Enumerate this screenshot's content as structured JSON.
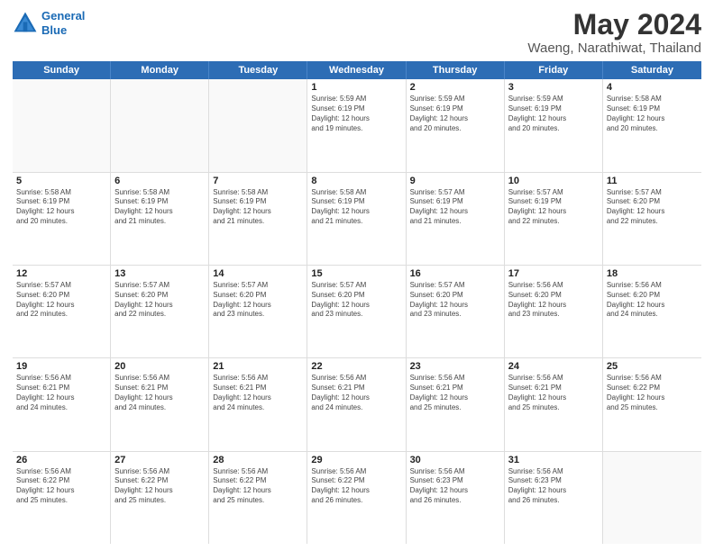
{
  "logo": {
    "line1": "General",
    "line2": "Blue"
  },
  "title": "May 2024",
  "subtitle": "Waeng, Narathiwat, Thailand",
  "weekdays": [
    "Sunday",
    "Monday",
    "Tuesday",
    "Wednesday",
    "Thursday",
    "Friday",
    "Saturday"
  ],
  "weeks": [
    [
      {
        "day": "",
        "info": ""
      },
      {
        "day": "",
        "info": ""
      },
      {
        "day": "",
        "info": ""
      },
      {
        "day": "1",
        "info": "Sunrise: 5:59 AM\nSunset: 6:19 PM\nDaylight: 12 hours\nand 19 minutes."
      },
      {
        "day": "2",
        "info": "Sunrise: 5:59 AM\nSunset: 6:19 PM\nDaylight: 12 hours\nand 20 minutes."
      },
      {
        "day": "3",
        "info": "Sunrise: 5:59 AM\nSunset: 6:19 PM\nDaylight: 12 hours\nand 20 minutes."
      },
      {
        "day": "4",
        "info": "Sunrise: 5:58 AM\nSunset: 6:19 PM\nDaylight: 12 hours\nand 20 minutes."
      }
    ],
    [
      {
        "day": "5",
        "info": "Sunrise: 5:58 AM\nSunset: 6:19 PM\nDaylight: 12 hours\nand 20 minutes."
      },
      {
        "day": "6",
        "info": "Sunrise: 5:58 AM\nSunset: 6:19 PM\nDaylight: 12 hours\nand 21 minutes."
      },
      {
        "day": "7",
        "info": "Sunrise: 5:58 AM\nSunset: 6:19 PM\nDaylight: 12 hours\nand 21 minutes."
      },
      {
        "day": "8",
        "info": "Sunrise: 5:58 AM\nSunset: 6:19 PM\nDaylight: 12 hours\nand 21 minutes."
      },
      {
        "day": "9",
        "info": "Sunrise: 5:57 AM\nSunset: 6:19 PM\nDaylight: 12 hours\nand 21 minutes."
      },
      {
        "day": "10",
        "info": "Sunrise: 5:57 AM\nSunset: 6:19 PM\nDaylight: 12 hours\nand 22 minutes."
      },
      {
        "day": "11",
        "info": "Sunrise: 5:57 AM\nSunset: 6:20 PM\nDaylight: 12 hours\nand 22 minutes."
      }
    ],
    [
      {
        "day": "12",
        "info": "Sunrise: 5:57 AM\nSunset: 6:20 PM\nDaylight: 12 hours\nand 22 minutes."
      },
      {
        "day": "13",
        "info": "Sunrise: 5:57 AM\nSunset: 6:20 PM\nDaylight: 12 hours\nand 22 minutes."
      },
      {
        "day": "14",
        "info": "Sunrise: 5:57 AM\nSunset: 6:20 PM\nDaylight: 12 hours\nand 23 minutes."
      },
      {
        "day": "15",
        "info": "Sunrise: 5:57 AM\nSunset: 6:20 PM\nDaylight: 12 hours\nand 23 minutes."
      },
      {
        "day": "16",
        "info": "Sunrise: 5:57 AM\nSunset: 6:20 PM\nDaylight: 12 hours\nand 23 minutes."
      },
      {
        "day": "17",
        "info": "Sunrise: 5:56 AM\nSunset: 6:20 PM\nDaylight: 12 hours\nand 23 minutes."
      },
      {
        "day": "18",
        "info": "Sunrise: 5:56 AM\nSunset: 6:20 PM\nDaylight: 12 hours\nand 24 minutes."
      }
    ],
    [
      {
        "day": "19",
        "info": "Sunrise: 5:56 AM\nSunset: 6:21 PM\nDaylight: 12 hours\nand 24 minutes."
      },
      {
        "day": "20",
        "info": "Sunrise: 5:56 AM\nSunset: 6:21 PM\nDaylight: 12 hours\nand 24 minutes."
      },
      {
        "day": "21",
        "info": "Sunrise: 5:56 AM\nSunset: 6:21 PM\nDaylight: 12 hours\nand 24 minutes."
      },
      {
        "day": "22",
        "info": "Sunrise: 5:56 AM\nSunset: 6:21 PM\nDaylight: 12 hours\nand 24 minutes."
      },
      {
        "day": "23",
        "info": "Sunrise: 5:56 AM\nSunset: 6:21 PM\nDaylight: 12 hours\nand 25 minutes."
      },
      {
        "day": "24",
        "info": "Sunrise: 5:56 AM\nSunset: 6:21 PM\nDaylight: 12 hours\nand 25 minutes."
      },
      {
        "day": "25",
        "info": "Sunrise: 5:56 AM\nSunset: 6:22 PM\nDaylight: 12 hours\nand 25 minutes."
      }
    ],
    [
      {
        "day": "26",
        "info": "Sunrise: 5:56 AM\nSunset: 6:22 PM\nDaylight: 12 hours\nand 25 minutes."
      },
      {
        "day": "27",
        "info": "Sunrise: 5:56 AM\nSunset: 6:22 PM\nDaylight: 12 hours\nand 25 minutes."
      },
      {
        "day": "28",
        "info": "Sunrise: 5:56 AM\nSunset: 6:22 PM\nDaylight: 12 hours\nand 25 minutes."
      },
      {
        "day": "29",
        "info": "Sunrise: 5:56 AM\nSunset: 6:22 PM\nDaylight: 12 hours\nand 26 minutes."
      },
      {
        "day": "30",
        "info": "Sunrise: 5:56 AM\nSunset: 6:23 PM\nDaylight: 12 hours\nand 26 minutes."
      },
      {
        "day": "31",
        "info": "Sunrise: 5:56 AM\nSunset: 6:23 PM\nDaylight: 12 hours\nand 26 minutes."
      },
      {
        "day": "",
        "info": ""
      }
    ]
  ]
}
